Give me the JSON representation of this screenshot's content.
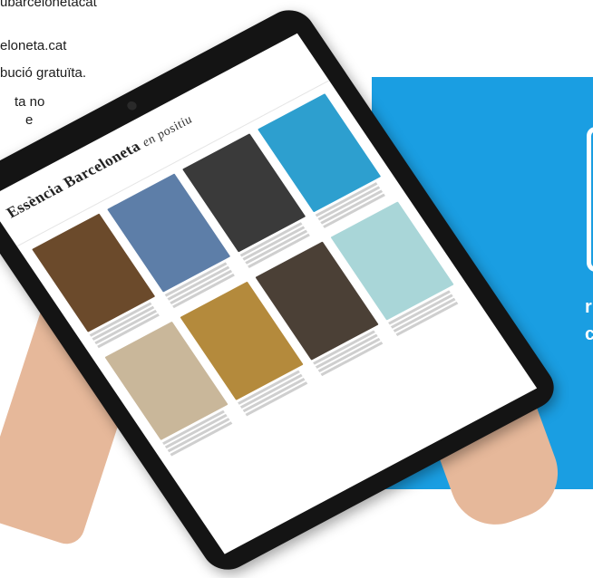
{
  "background_text": [
    "ubarcelonetacat",
    "eloneta.cat",
    "bució gratuïta.",
    "ta no",
    "e"
  ],
  "side_panel": {
    "color": "#1a9ee2",
    "marks": [
      "r",
      "c"
    ]
  },
  "tablet_site": {
    "logo_bold": "Essència Barceloneta",
    "logo_italic": "en positiu",
    "articles": [
      {
        "color": "#6b4a2b",
        "headline": ""
      },
      {
        "color": "#5d7ea8",
        "headline": ""
      },
      {
        "color": "#3a3a3a",
        "headline": ""
      },
      {
        "color": "#2d9fcf",
        "headline": ""
      },
      {
        "color": "#c9b79a",
        "headline": ""
      },
      {
        "color": "#b48a3c",
        "headline": ""
      },
      {
        "color": "#4b4036",
        "headline": ""
      },
      {
        "color": "#a9d6d8",
        "headline": ""
      }
    ]
  }
}
